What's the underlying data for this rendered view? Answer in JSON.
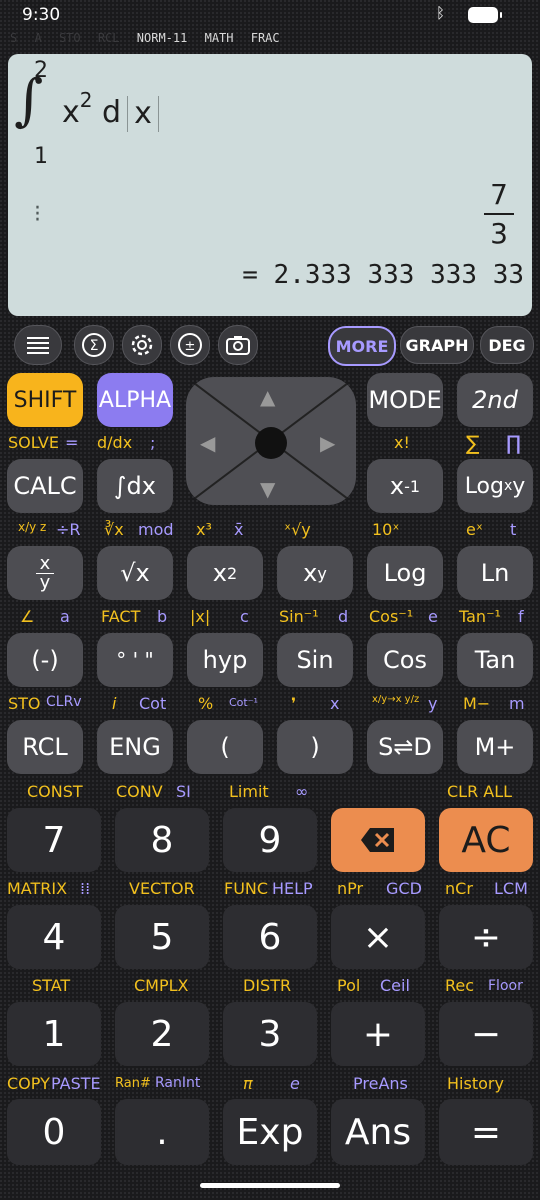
{
  "status": {
    "time": "9:30"
  },
  "indicators": {
    "dim": [
      "S",
      "A",
      "STO",
      "RCL"
    ],
    "active": [
      "NORM-11",
      "MATH",
      "FRAC"
    ]
  },
  "display": {
    "integral_upper": "2",
    "integral_lower": "1",
    "expr_base": "x",
    "expr_exp": "2",
    "expr_d": "d",
    "expr_var": "x",
    "result_num": "7",
    "result_den": "3",
    "decimal": "= 2.333 333 333 33"
  },
  "toolbar": {
    "more": "MORE",
    "graph": "GRAPH",
    "deg": "DEG"
  },
  "colors": {
    "yellow": "#f2c01e",
    "purple": "#a79aff",
    "orange": "#ec8d4f",
    "shift": "#f8b41c",
    "alpha": "#8c7cf0"
  },
  "keys": {
    "shift": "SHIFT",
    "alpha": "ALPHA",
    "mode": "MODE",
    "second": "2nd",
    "calc": "CALC",
    "integral": "∫dx",
    "inverse_base": "x",
    "inverse_exp": "-1",
    "log_x_y": "Log",
    "log_x_sub": "x",
    "log_x_y2": "y",
    "frac_top": "x",
    "frac_bot": "y",
    "sqrt": "√x",
    "square_base": "x",
    "square_exp": "2",
    "power_base": "x",
    "power_exp": "y",
    "log": "Log",
    "ln": "Ln",
    "neg": "(-)",
    "dms": "° ' \"",
    "hyp": "hyp",
    "sin": "Sin",
    "cos": "Cos",
    "tan": "Tan",
    "rcl": "RCL",
    "eng": "ENG",
    "lparen": "(",
    "rparen": ")",
    "sd": "S⇌D",
    "mplus": "M+",
    "n7": "7",
    "n8": "8",
    "n9": "9",
    "ac": "AC",
    "n4": "4",
    "n5": "5",
    "n6": "6",
    "times": "×",
    "divide": "÷",
    "n1": "1",
    "n2": "2",
    "n3": "3",
    "plus": "+",
    "minus": "−",
    "n0": "0",
    "dot": ".",
    "exp": "Exp",
    "ans": "Ans",
    "equals": "="
  },
  "labels": {
    "solve": "SOLVE",
    "solve_eq": "=",
    "ddx": "d/dx",
    "semi": ";",
    "xfact": "x!",
    "sigma": "∑",
    "pi_prod": "∏",
    "ab_c": "x/y z",
    "div_r": "÷R",
    "cbrt": "∛x",
    "mod": "mod",
    "cube": "x³",
    "mean": "x̄",
    "yroot": "ˣ√y",
    "ten_x": "10ˣ",
    "e_x": "eˣ",
    "t": "t",
    "angle": "∠",
    "a": "a",
    "fact": "FACT",
    "b": "b",
    "abs": "|x|",
    "c": "c",
    "asin": "Sin⁻¹",
    "d": "d",
    "acos": "Cos⁻¹",
    "e": "e",
    "atan": "Tan⁻¹",
    "f": "f",
    "sto": "STO",
    "clrv": "CLRv",
    "i": "i",
    "cot": "Cot",
    "pct": "%",
    "acot": "Cot⁻¹",
    "comma": "❜",
    "x": "x",
    "conv_frac": "x/y→x y/z",
    "y": "y",
    "mminus": "M−",
    "m": "m",
    "const": "CONST",
    "conv": "CONV",
    "si": "SI",
    "limit": "Limit",
    "inf": "∞",
    "clr_all": "CLR ALL",
    "matrix": "MATRIX",
    "vector": "VECTOR",
    "func": "FUNC",
    "help": "HELP",
    "npr": "nPr",
    "gcd": "GCD",
    "ncr": "nCr",
    "lcm": "LCM",
    "stat": "STAT",
    "cmplx": "CMPLX",
    "distr": "DISTR",
    "pol": "Pol",
    "ceil": "Ceil",
    "rec": "Rec",
    "floor": "Floor",
    "copy": "COPY",
    "paste": "PASTE",
    "ran": "Ran#",
    "ranint": "RanInt",
    "pi": "π",
    "econst": "e",
    "preans": "PreAns",
    "history": "History"
  }
}
